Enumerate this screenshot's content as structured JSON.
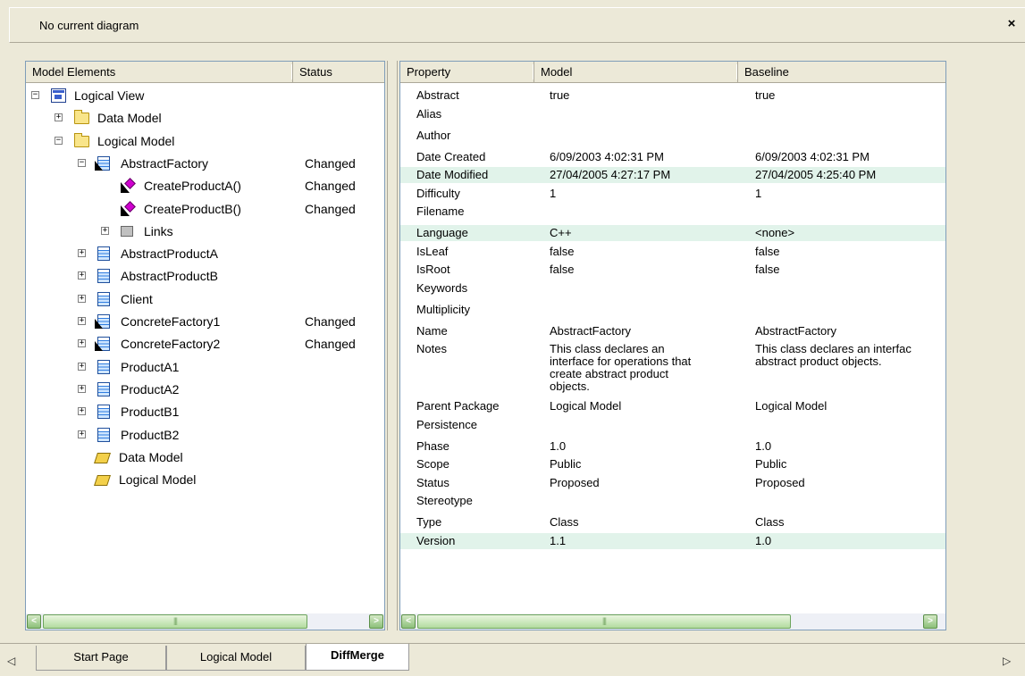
{
  "window": {
    "title": "No current diagram",
    "close_glyph": "×"
  },
  "tree_pane": {
    "columns": [
      "Model Elements",
      "Status"
    ],
    "rows": [
      {
        "label": "Logical View",
        "icon": "view-icon",
        "toggle": "−",
        "status": ""
      },
      {
        "label": "Data Model",
        "icon": "folder-icon",
        "toggle": "+",
        "status": ""
      },
      {
        "label": "Logical Model",
        "icon": "folder-icon",
        "toggle": "−",
        "status": ""
      },
      {
        "label": "AbstractFactory",
        "icon": "abstract-class-icon",
        "toggle": "−",
        "status": "Changed"
      },
      {
        "label": "CreateProductA()",
        "icon": "operation-icon",
        "toggle": "",
        "status": "Changed"
      },
      {
        "label": "CreateProductB()",
        "icon": "operation-icon",
        "toggle": "",
        "status": "Changed"
      },
      {
        "label": "Links",
        "icon": "links-icon",
        "toggle": "+",
        "status": ""
      },
      {
        "label": "AbstractProductA",
        "icon": "class-icon",
        "toggle": "+",
        "status": ""
      },
      {
        "label": "AbstractProductB",
        "icon": "class-icon",
        "toggle": "+",
        "status": ""
      },
      {
        "label": "Client",
        "icon": "class-icon",
        "toggle": "+",
        "status": ""
      },
      {
        "label": "ConcreteFactory1",
        "icon": "abstract-class-icon",
        "toggle": "+",
        "status": "Changed"
      },
      {
        "label": "ConcreteFactory2",
        "icon": "abstract-class-icon",
        "toggle": "+",
        "status": "Changed"
      },
      {
        "label": "ProductA1",
        "icon": "class-icon",
        "toggle": "+",
        "status": ""
      },
      {
        "label": "ProductA2",
        "icon": "class-icon",
        "toggle": "+",
        "status": ""
      },
      {
        "label": "ProductB1",
        "icon": "class-icon",
        "toggle": "+",
        "status": ""
      },
      {
        "label": "ProductB2",
        "icon": "class-icon",
        "toggle": "+",
        "status": ""
      },
      {
        "label": "Data Model",
        "icon": "open-folder-icon",
        "toggle": "",
        "status": ""
      },
      {
        "label": "Logical Model",
        "icon": "open-folder-icon",
        "toggle": "",
        "status": ""
      }
    ],
    "scroll_left": "<",
    "scroll_right": ">"
  },
  "prop_pane": {
    "columns": [
      "Property",
      "Model",
      "Baseline"
    ],
    "rows": [
      {
        "property": "Abstract",
        "model": [
          "true"
        ],
        "baseline": [
          "true"
        ],
        "highlight": false
      },
      {
        "property": "Alias",
        "model": [],
        "baseline": [],
        "highlight": false
      },
      {
        "property": "Author",
        "model": [],
        "baseline": [],
        "highlight": false
      },
      {
        "property": "Date Created",
        "model": [
          "6/09/2003 4:02:31 PM"
        ],
        "baseline": [
          "6/09/2003 4:02:31 PM"
        ],
        "highlight": false
      },
      {
        "property": "Date Modified",
        "model": [
          "27/04/2005 4:27:17 PM"
        ],
        "baseline": [
          "27/04/2005 4:25:40 PM"
        ],
        "highlight": true
      },
      {
        "property": "Difficulty",
        "model": [
          "1"
        ],
        "baseline": [
          "1"
        ],
        "highlight": false
      },
      {
        "property": "Filename",
        "model": [],
        "baseline": [],
        "highlight": false
      },
      {
        "property": "Language",
        "model": [
          "C++"
        ],
        "baseline": [
          "<none>"
        ],
        "highlight": true
      },
      {
        "property": "IsLeaf",
        "model": [
          "false"
        ],
        "baseline": [
          "false"
        ],
        "highlight": false
      },
      {
        "property": "IsRoot",
        "model": [
          "false"
        ],
        "baseline": [
          "false"
        ],
        "highlight": false
      },
      {
        "property": "Keywords",
        "model": [],
        "baseline": [],
        "highlight": false
      },
      {
        "property": "Multiplicity",
        "model": [],
        "baseline": [],
        "highlight": false
      },
      {
        "property": "Name",
        "model": [
          "AbstractFactory"
        ],
        "baseline": [
          "AbstractFactory"
        ],
        "highlight": false
      },
      {
        "property": "Notes",
        "model": [
          "This class declares an",
          "interface for operations that",
          "create abstract product",
          "objects."
        ],
        "baseline": [
          "This class declares an interfac",
          "abstract product objects."
        ],
        "highlight": false
      },
      {
        "property": "Parent Package",
        "model": [
          "Logical Model"
        ],
        "baseline": [
          "Logical Model"
        ],
        "highlight": false
      },
      {
        "property": "Persistence",
        "model": [],
        "baseline": [],
        "highlight": false
      },
      {
        "property": "Phase",
        "model": [
          "1.0"
        ],
        "baseline": [
          "1.0"
        ],
        "highlight": false
      },
      {
        "property": "Scope",
        "model": [
          "Public"
        ],
        "baseline": [
          "Public"
        ],
        "highlight": false
      },
      {
        "property": "Status",
        "model": [
          "Proposed"
        ],
        "baseline": [
          "Proposed"
        ],
        "highlight": false
      },
      {
        "property": "Stereotype",
        "model": [],
        "baseline": [],
        "highlight": false
      },
      {
        "property": "Type",
        "model": [
          "Class"
        ],
        "baseline": [
          "Class"
        ],
        "highlight": false
      },
      {
        "property": "Version",
        "model": [
          "1.1"
        ],
        "baseline": [
          "1.0"
        ],
        "highlight": true
      }
    ]
  },
  "tabs": {
    "items": [
      "Start Page",
      "Logical Model",
      "DiffMerge"
    ],
    "active": "DiffMerge",
    "left_arrow": "◁",
    "right_arrow": "▷"
  }
}
